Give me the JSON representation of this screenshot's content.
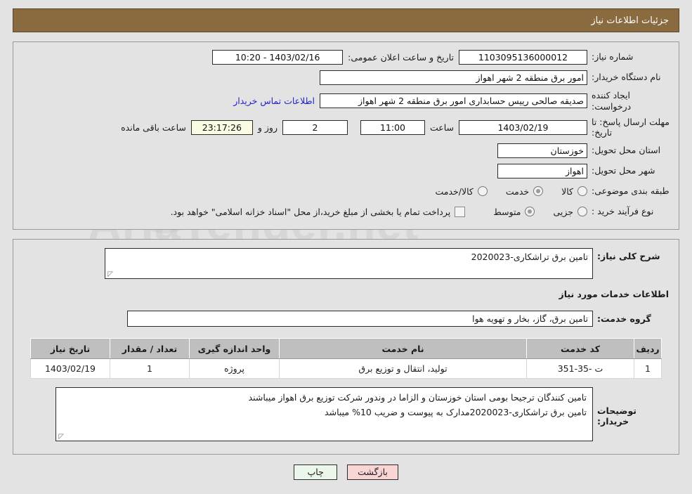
{
  "header": {
    "title": "جزئیات اطلاعات نیاز"
  },
  "form": {
    "need_number_label": "شماره نیاز:",
    "need_number_value": "1103095136000012",
    "announce_label": "تاریخ و ساعت اعلان عمومی:",
    "announce_value": "1403/02/16 - 10:20",
    "buyer_org_label": "نام دستگاه خریدار:",
    "buyer_org_value": "امور برق منطقه 2 شهر اهواز",
    "creator_label": "ایجاد کننده درخواست:",
    "creator_value": "صدیقه صالحی رییس حسابداری امور برق منطقه 2 شهر اهواز",
    "contact_link": "اطلاعات تماس خریدار",
    "deadline_label_line1": "مهلت ارسال پاسخ: تا",
    "deadline_label_line2": "تاریخ:",
    "deadline_date": "1403/02/19",
    "hour_label": "ساعت",
    "hour_value": "11:00",
    "days_value": "2",
    "days_label": "روز و",
    "remaining_value": "23:17:26",
    "remaining_label": "ساعت باقی مانده",
    "province_label": "استان محل تحویل:",
    "province_value": "خوزستان",
    "city_label": "شهر محل تحویل:",
    "city_value": "اهواز",
    "category_label": "طبقه بندی موضوعی:",
    "category_options": [
      {
        "label": "کالا",
        "checked": false
      },
      {
        "label": "خدمت",
        "checked": true
      },
      {
        "label": "کالا/خدمت",
        "checked": false
      }
    ],
    "process_label": "نوع فرآیند خرید :",
    "process_options": [
      {
        "label": "جزیی",
        "checked": false
      },
      {
        "label": "متوسط",
        "checked": true
      }
    ],
    "treasury_checked": false,
    "treasury_note": "پرداخت تمام یا بخشی از مبلغ خرید،از محل \"اسناد خزانه اسلامی\" خواهد بود."
  },
  "description": {
    "general_label": "شرح کلی نیاز:",
    "general_value": "تامین برق تراشکاری-2020023",
    "services_heading": "اطلاعات خدمات مورد نیاز",
    "service_group_label": "گروه خدمت:",
    "service_group_value": "تامین برق، گاز، بخار و تهویه هوا"
  },
  "items_table": {
    "columns": [
      "ردیف",
      "کد خدمت",
      "نام خدمت",
      "واحد اندازه گیری",
      "تعداد / مقدار",
      "تاریخ نیاز"
    ],
    "rows": [
      {
        "radif": "1",
        "code": "ت -35-351",
        "name": "تولید، انتقال و توزیع برق",
        "unit": "پروژه",
        "qty": "1",
        "date": "1403/02/19"
      }
    ]
  },
  "buyer_notes": {
    "label": "توضیحات خریدار:",
    "line1": "تامین کنندگان ترجیحا بومی استان خوزستان و الزاما در وندور شرکت توزیع برق اهواز میباشند",
    "line2": "تامین برق تراشکاری-2020023مدارک به پیوست و ضریب 10% میباشد"
  },
  "buttons": {
    "print": "چاپ",
    "back": "بازگشت"
  },
  "watermark": {
    "text": "AriaTender.net"
  },
  "colors": {
    "header_bg": "#8a6b3f",
    "page_bg": "#e3e3e3",
    "link": "#2222cc",
    "print_btn": "#eaf7ea",
    "back_btn": "#fad5d5",
    "table_header": "#bfbfbf",
    "highlight_field": "#fbfbe4"
  }
}
